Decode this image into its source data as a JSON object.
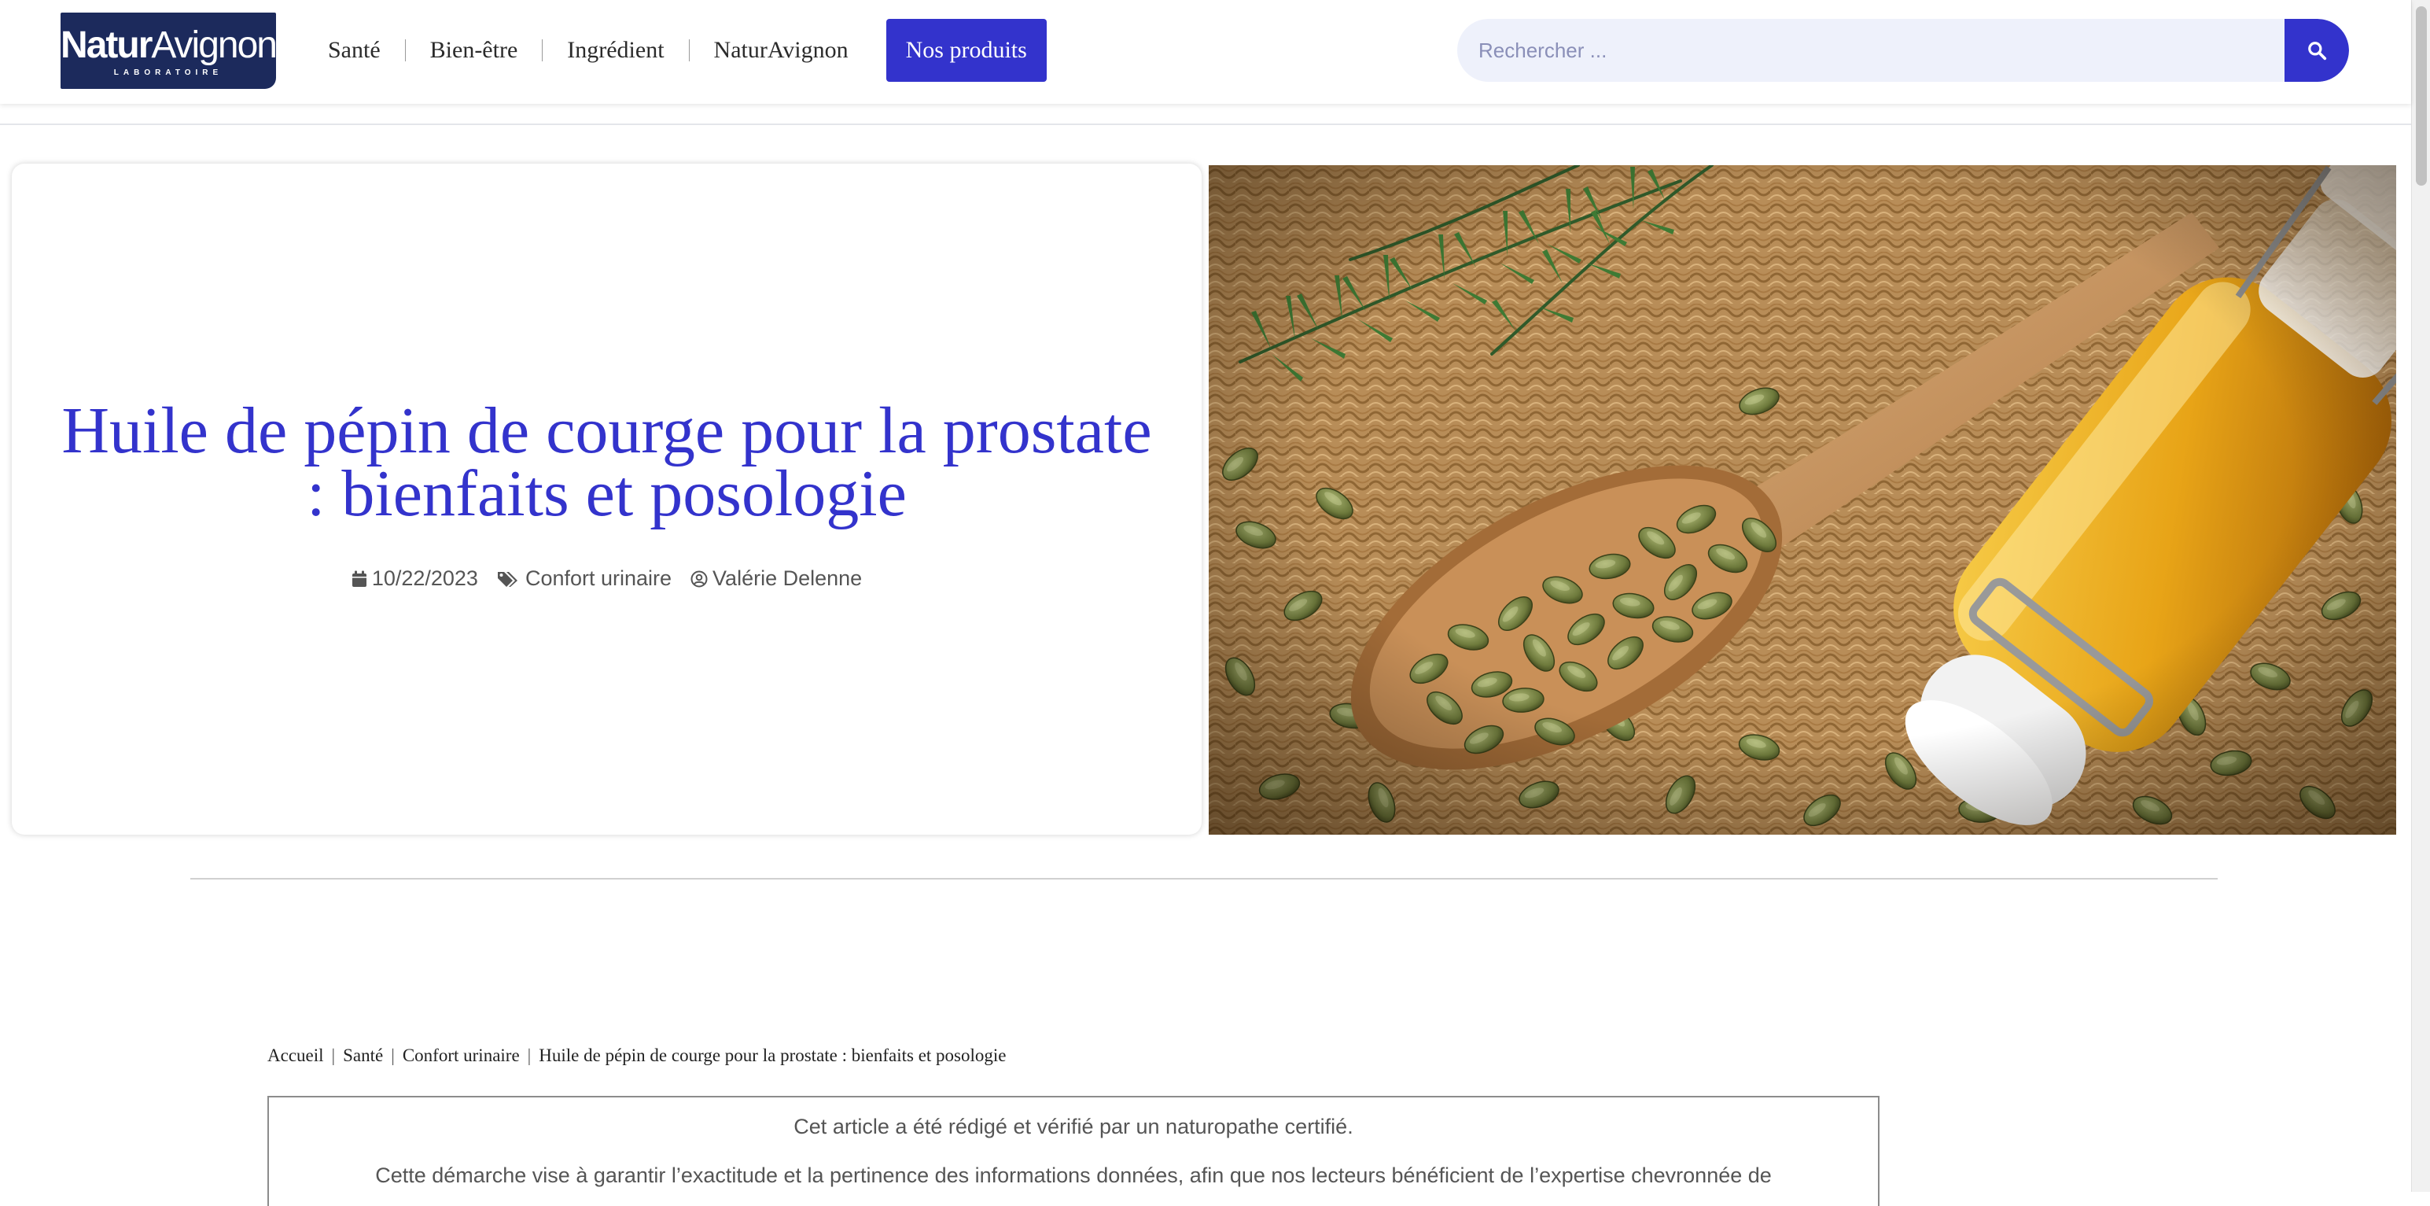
{
  "header": {
    "logo": {
      "name_bold": "Natur",
      "name_light": "Avignon",
      "subtitle": "LABORATOIRE"
    },
    "nav": [
      {
        "label": "Santé"
      },
      {
        "label": "Bien-être"
      },
      {
        "label": "Ingrédient"
      },
      {
        "label": "NaturAvignon"
      }
    ],
    "cta_label": "Nos produits",
    "search": {
      "placeholder": "Rechercher ...",
      "value": ""
    }
  },
  "hero": {
    "title": "Huile de pépin de courge pour la prostate : bienfaits et posologie",
    "date": "10/22/2023",
    "category": "Confort urinaire",
    "author": "Valérie Delenne",
    "image_alt": "Graines de courge dans une cuillère en bois et bouteille d'huile sur une natte tressée"
  },
  "breadcrumb": {
    "items": [
      {
        "label": "Accueil"
      },
      {
        "label": "Santé"
      },
      {
        "label": "Confort urinaire"
      }
    ],
    "current": "Huile de pépin de courge pour la prostate : bienfaits et posologie"
  },
  "notice": {
    "line1": "Cet article a été rédigé et vérifié par un naturopathe certifié.",
    "line2": "Cette démarche vise à garantir l’exactitude et la pertinence des informations données, afin que nos lecteurs bénéficient de l’expertise chevronnée de"
  },
  "colors": {
    "brand_navy": "#1c2a5c",
    "accent_blue": "#3333cc",
    "search_bg": "#eef1fb"
  },
  "icons": {
    "search": "search-icon",
    "date": "calendar-icon",
    "category": "tags-icon",
    "author": "user-circle-icon"
  }
}
